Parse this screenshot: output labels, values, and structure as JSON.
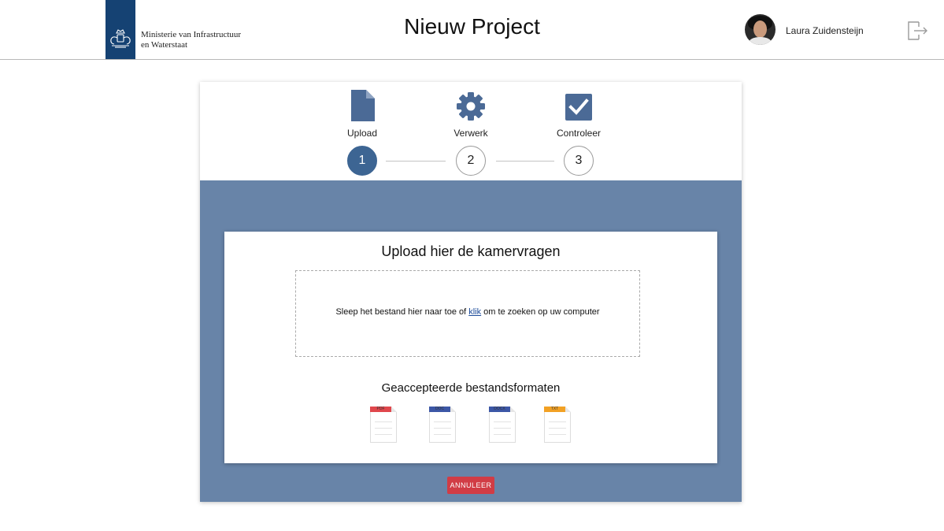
{
  "header": {
    "ministry_line1": "Ministerie van Infrastructuur",
    "ministry_line2": "en Waterstaat",
    "title": "Nieuw Project",
    "user_name": "Laura Zuidensteijn",
    "icons": {
      "logo": "coat-of-arms-icon",
      "logout": "logout-icon"
    }
  },
  "steps": [
    {
      "label": "Upload",
      "number": "1",
      "icon": "file-icon",
      "active": true
    },
    {
      "label": "Verwerk",
      "number": "2",
      "icon": "gear-icon",
      "active": false
    },
    {
      "label": "Controleer",
      "number": "3",
      "icon": "checkbox-icon",
      "active": false
    }
  ],
  "upload": {
    "title": "Upload hier de kamervragen",
    "drop_text_before": "Sleep het bestand hier naar toe of ",
    "drop_link": "klik",
    "drop_text_after": " om te zoeken op uw computer",
    "formats_title": "Geaccepteerde bestandsformaten",
    "formats": [
      {
        "label": "PDF",
        "color": "#e0474c"
      },
      {
        "label": "DOC",
        "color": "#3c57a6"
      },
      {
        "label": "DOCX",
        "color": "#3c57a6"
      },
      {
        "label": "TXT",
        "color": "#f2a124"
      }
    ]
  },
  "actions": {
    "cancel_label": "ANNULEER"
  },
  "colors": {
    "brand_blue": "#154273",
    "step_active": "#3d6593",
    "panel_background": "#6884a8",
    "cancel_red": "#d13c45",
    "icon_blue": "#4b6a96"
  }
}
